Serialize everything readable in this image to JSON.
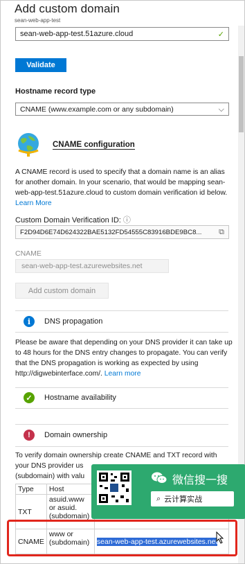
{
  "header": {
    "title": "Add custom domain",
    "subtitle": "sean-web-app-test"
  },
  "domain_input": {
    "value": "sean-web-app-test.51azure.cloud",
    "valid_icon": "check-icon"
  },
  "validate_button": "Validate",
  "hostname_record": {
    "label": "Hostname record type",
    "selected": "CNAME (www.example.com or any subdomain)"
  },
  "cname_config": {
    "title": "CNAME configuration",
    "description": "A CNAME record is used to specify that a domain name is an alias for another domain. In your scenario, that would be mapping sean-web-app-test.51azure.cloud to custom domain verification id below.",
    "learn_more": "Learn More",
    "verification_label": "Custom Domain Verification ID:",
    "verification_value": "F2D94D6E74D624322BAE5132FD54555C83916BDE9BC8...",
    "cname_label": "CNAME",
    "cname_value": "sean-web-app-test.azurewebsites.net",
    "add_button": "Add custom domain"
  },
  "dns_propagation": {
    "title": "DNS propagation",
    "text": "Please be aware that depending on your DNS provider it can take up to 48 hours for the DNS entry changes to propagate. You can verify that the DNS propagation is working as expected by using http://digwebinterface.com/.",
    "learn_more": "Learn more"
  },
  "hostname_availability": {
    "title": "Hostname availability"
  },
  "domain_ownership": {
    "title": "Domain ownership",
    "text_line1": "To verify domain ownership create CNAME and TXT record with",
    "text_line2": "your DNS provider us",
    "text_line3": "(subdomain) with valu"
  },
  "dns_table": {
    "headers": [
      "Type",
      "Host"
    ],
    "rows": [
      {
        "type": "TXT",
        "host": "asuid.www or asuid. (subdomain)",
        "value": ""
      },
      {
        "type": "CNAME",
        "host": "www or (subdomain)",
        "value": "sean-web-app-test.azurewebsites.net"
      }
    ]
  },
  "overlay": {
    "wechat_text": "微信搜一搜",
    "search_text": "云计算实战"
  },
  "colors": {
    "accent": "#0078d4",
    "success": "#57a300",
    "error": "#c4314b",
    "overlay": "#2da96f",
    "annotation": "#e1261c"
  }
}
